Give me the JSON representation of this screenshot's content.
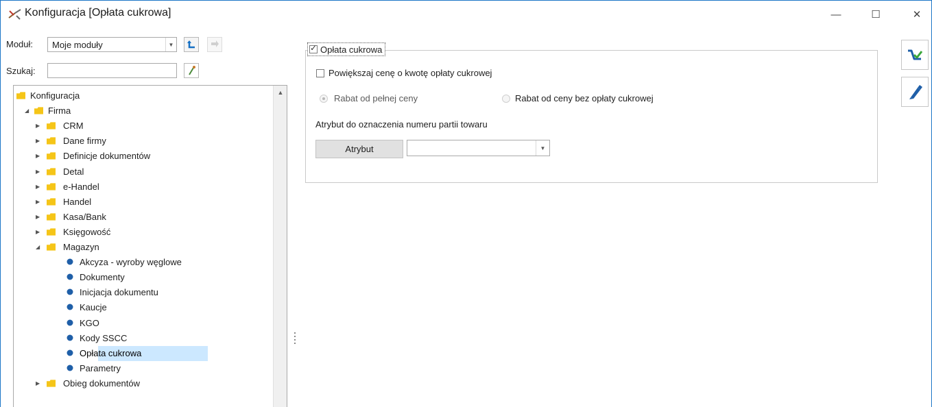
{
  "window": {
    "title": "Konfiguracja [Opłata cukrowa]",
    "minimize_glyph": "—",
    "maximize_glyph": "☐",
    "close_glyph": "✕"
  },
  "left": {
    "module_label": "Moduł:",
    "module_value": "Moje moduły",
    "search_label": "Szukaj:",
    "search_value": ""
  },
  "tree": {
    "items": [
      {
        "label": "Konfiguracja",
        "level": 0,
        "kind": "folder",
        "expander": "none"
      },
      {
        "label": "Firma",
        "level": 1,
        "kind": "folder",
        "expander": "open"
      },
      {
        "label": "CRM",
        "level": 2,
        "kind": "folder",
        "expander": "closed"
      },
      {
        "label": "Dane firmy",
        "level": 2,
        "kind": "folder",
        "expander": "closed"
      },
      {
        "label": "Definicje dokumentów",
        "level": 2,
        "kind": "folder",
        "expander": "closed"
      },
      {
        "label": "Detal",
        "level": 2,
        "kind": "folder",
        "expander": "closed"
      },
      {
        "label": "e-Handel",
        "level": 2,
        "kind": "folder",
        "expander": "closed"
      },
      {
        "label": "Handel",
        "level": 2,
        "kind": "folder",
        "expander": "closed"
      },
      {
        "label": "Kasa/Bank",
        "level": 2,
        "kind": "folder",
        "expander": "closed"
      },
      {
        "label": "Księgowość",
        "level": 2,
        "kind": "folder",
        "expander": "closed"
      },
      {
        "label": "Magazyn",
        "level": 2,
        "kind": "folder",
        "expander": "open"
      },
      {
        "label": "Akcyza - wyroby węglowe",
        "level": 3,
        "kind": "leaf",
        "expander": "none"
      },
      {
        "label": "Dokumenty",
        "level": 3,
        "kind": "leaf",
        "expander": "none"
      },
      {
        "label": "Inicjacja dokumentu",
        "level": 3,
        "kind": "leaf",
        "expander": "none"
      },
      {
        "label": "Kaucje",
        "level": 3,
        "kind": "leaf",
        "expander": "none"
      },
      {
        "label": "KGO",
        "level": 3,
        "kind": "leaf",
        "expander": "none"
      },
      {
        "label": "Kody SSCC",
        "level": 3,
        "kind": "leaf",
        "expander": "none"
      },
      {
        "label": "Opłata cukrowa",
        "level": 3,
        "kind": "leaf",
        "expander": "none",
        "selected": true
      },
      {
        "label": "Parametry",
        "level": 3,
        "kind": "leaf",
        "expander": "none"
      },
      {
        "label": "Obieg dokumentów",
        "level": 2,
        "kind": "folder",
        "expander": "closed"
      }
    ]
  },
  "form": {
    "group_label": "Opłata cukrowa",
    "group_checked": true,
    "increase_price_label": "Powiększaj cenę o kwotę opłaty cukrowej",
    "increase_price_checked": false,
    "radio_full_price": "Rabat od pełnej ceny",
    "radio_full_price_checked": true,
    "radio_without_fee": "Rabat od ceny bez opłaty cukrowej",
    "radio_without_fee_checked": false,
    "attribute_caption": "Atrybut do oznaczenia numeru partii towaru",
    "attribute_button": "Atrybut",
    "attribute_value": ""
  },
  "colors": {
    "accent": "#1b76c7",
    "folder_yellow": "#f5c518",
    "leaf_blue": "#1f5fa8",
    "selection": "#cce8ff"
  },
  "icons": {
    "app": "config-tools-icon",
    "save": "save-cart-icon",
    "help": "pen-icon"
  }
}
